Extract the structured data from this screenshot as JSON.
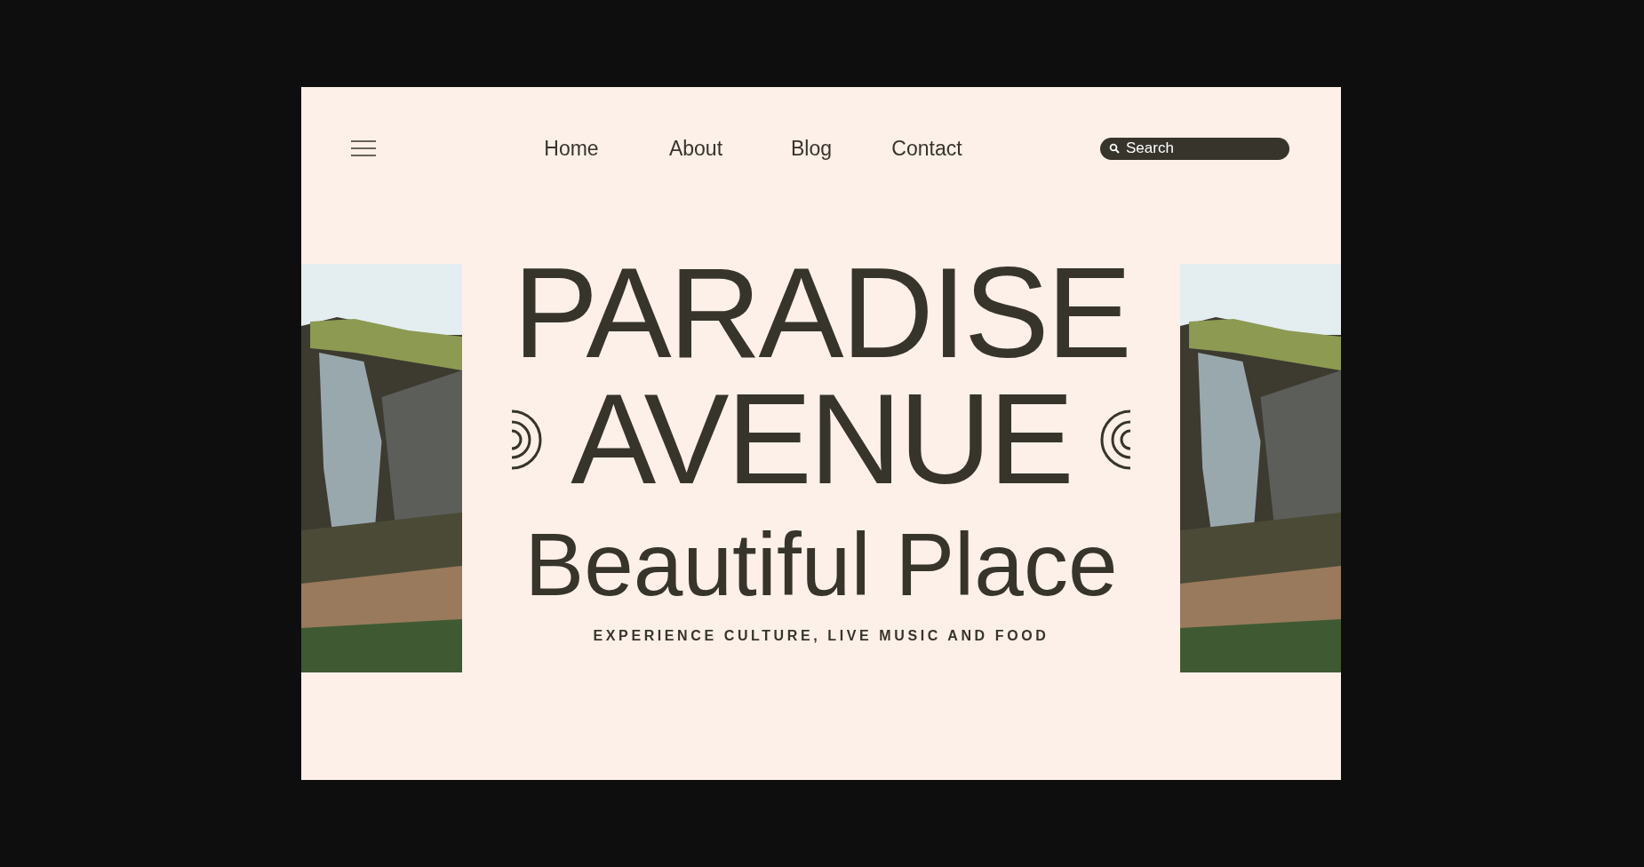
{
  "nav": {
    "items": [
      "Home",
      "About",
      "Blog",
      "Contact"
    ]
  },
  "search": {
    "placeholder": "Search"
  },
  "hero": {
    "title_lines": [
      "PARADISE",
      "AVENUE"
    ],
    "subtitle": "Beautiful Place",
    "tagline": "EXPERIENCE CULTURE, LIVE MUSIC AND FOOD"
  }
}
